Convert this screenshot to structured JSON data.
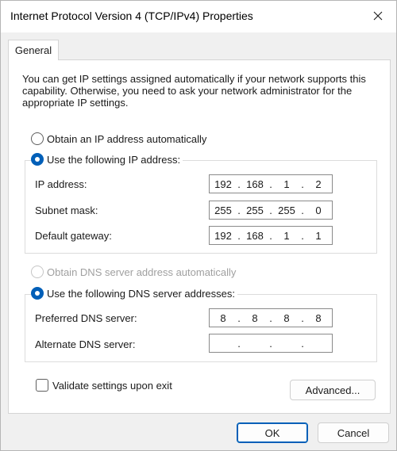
{
  "window": {
    "title": "Internet Protocol Version 4 (TCP/IPv4) Properties",
    "close_icon": "close-icon"
  },
  "tabs": [
    {
      "label": "General",
      "active": true
    }
  ],
  "general": {
    "description": "You can get IP settings assigned automatically if your network supports this capability. Otherwise, you need to ask your network administrator for the appropriate IP settings.",
    "ip": {
      "auto_label": "Obtain an IP address automatically",
      "manual_label": "Use the following IP address:",
      "selected": "manual",
      "fields": {
        "ip_address": {
          "label": "IP address:",
          "octets": [
            "192",
            "168",
            "1",
            "2"
          ]
        },
        "subnet_mask": {
          "label": "Subnet mask:",
          "octets": [
            "255",
            "255",
            "255",
            "0"
          ]
        },
        "default_gateway": {
          "label": "Default gateway:",
          "octets": [
            "192",
            "168",
            "1",
            "1"
          ]
        }
      }
    },
    "dns": {
      "auto_label": "Obtain DNS server address automatically",
      "auto_disabled": true,
      "manual_label": "Use the following DNS server addresses:",
      "selected": "manual",
      "fields": {
        "preferred": {
          "label": "Preferred DNS server:",
          "octets": [
            "8",
            "8",
            "8",
            "8"
          ]
        },
        "alternate": {
          "label": "Alternate DNS server:",
          "octets": [
            "",
            "",
            "",
            ""
          ]
        }
      }
    },
    "validate_label": "Validate settings upon exit",
    "validate_checked": false,
    "advanced_label": "Advanced..."
  },
  "buttons": {
    "ok": "OK",
    "cancel": "Cancel"
  },
  "colors": {
    "accent": "#005fb8",
    "window_bg": "#f0f0f0",
    "panel_bg": "#ffffff"
  }
}
